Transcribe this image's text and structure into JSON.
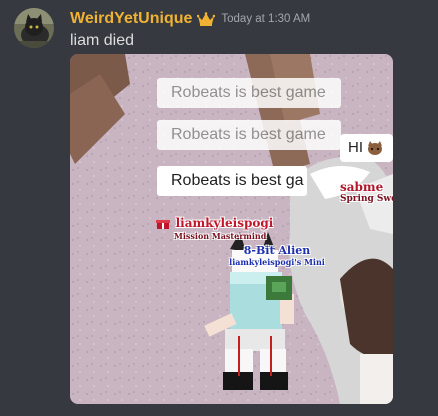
{
  "message": {
    "username": "WeirdYetUnique",
    "timestamp": "Today at 1:30 AM",
    "text": "liam died",
    "colors": {
      "username": "#f0b232",
      "background": "#36393f",
      "text": "#dcddde",
      "timestamp": "#a3a6aa"
    }
  },
  "attachment": {
    "chat_bubbles": [
      {
        "text": "Robeats is best game"
      },
      {
        "text": "Robeats is best game"
      },
      {
        "text": "Robeats is best ga"
      }
    ],
    "hi_bubble": {
      "text": "HI"
    },
    "nametags": {
      "player1": {
        "name": "liamkyleispogi",
        "subtitle": "Mission Mastermind"
      },
      "player2": {
        "name": "8-Bit Alien",
        "subtitle": "liamkyleispogi's Mini"
      },
      "player3": {
        "name": "sabme",
        "subtitle": "Spring Sweet"
      }
    }
  }
}
